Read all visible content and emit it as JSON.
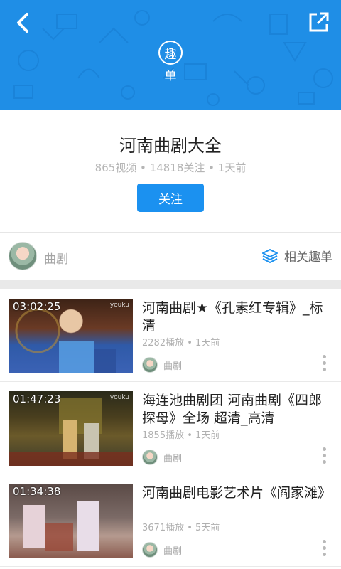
{
  "header": {
    "badge_char": "趣",
    "badge_text": "单"
  },
  "playlist": {
    "title": "河南曲剧大全",
    "stats": "865视频 • 14818关注 • 1天前",
    "follow_label": "关注"
  },
  "tagbar": {
    "tag": "曲剧",
    "related_label": "相关趣单"
  },
  "videos": [
    {
      "duration": "03:02:25",
      "title": "河南曲剧★《孔素红专辑》_标清",
      "meta": "2282播放 • 1天前",
      "author": "曲剧"
    },
    {
      "duration": "01:47:23",
      "title": "海连池曲剧团 河南曲剧《四郎探母》全场 超清_高清",
      "meta": "1855播放 • 1天前",
      "author": "曲剧"
    },
    {
      "duration": "01:34:38",
      "title": "河南曲剧电影艺术片《阎家滩》",
      "meta": "3671播放 • 5天前",
      "author": "曲剧"
    }
  ],
  "colors": {
    "header_bg": "#1f8ee6",
    "accent": "#1b91f0"
  }
}
